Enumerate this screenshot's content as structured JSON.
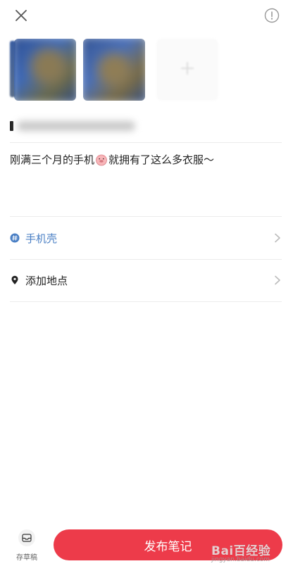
{
  "header": {
    "close_icon": "close-icon",
    "info_icon": "info-circle-icon"
  },
  "images": [
    {
      "kind": "photo",
      "state": "blurred"
    },
    {
      "kind": "photo",
      "state": "blurred"
    }
  ],
  "add_image_icon": "plus-icon",
  "note": {
    "text_before_emoji": "刚满三个月的手机",
    "emoji_icon": "pig-face-emoji",
    "text_after_emoji": "就拥有了这么多衣服～"
  },
  "topic": {
    "icon": "hashtag-icon",
    "label": "手机壳",
    "color": "#4a7fc4"
  },
  "location": {
    "icon": "location-pin-icon",
    "label": "添加地点"
  },
  "footer": {
    "draft_icon": "inbox-icon",
    "draft_label": "存草稿",
    "publish_label": "发布笔记",
    "publish_color": "#ed3b4a"
  },
  "watermark": {
    "main": "Bai百经验",
    "sub": "jingyan.baidu.com"
  }
}
